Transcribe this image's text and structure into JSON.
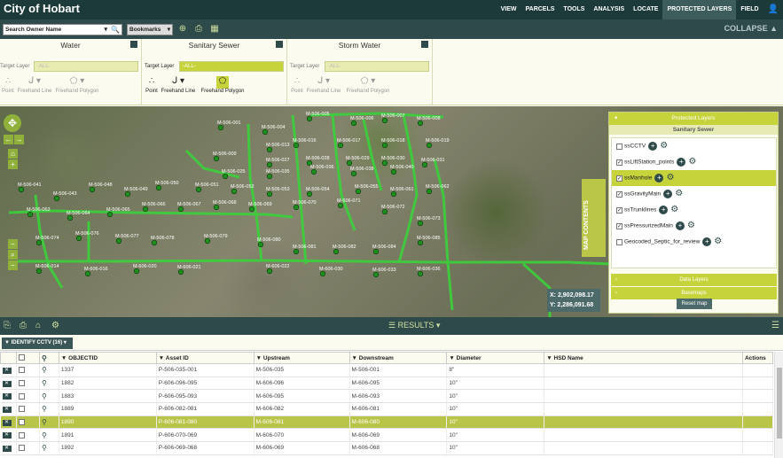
{
  "app": {
    "title": "City of Hobart"
  },
  "nav": [
    "VIEW",
    "PARCELS",
    "TOOLS",
    "ANALYSIS",
    "LOCATE",
    "PROTECTED LAYERS",
    "FIELD"
  ],
  "toolbar": {
    "search_value": "Search Owner Name",
    "bookmarks_label": "Bookmarks",
    "collapse_label": "COLLAPSE"
  },
  "edit_panels": [
    {
      "title": "Water",
      "target_label": "Target Layer",
      "target_value": "-ALL-",
      "tools": [
        "Point",
        "Freehand Line",
        "Freehand Polygon"
      ]
    },
    {
      "title": "Sanitary Sewer",
      "target_label": "Target Layer",
      "target_value": "-ALL-",
      "tools": [
        "Point",
        "Freehand Line",
        "Freehand Polygon"
      ]
    },
    {
      "title": "Storm Water",
      "target_label": "Target Layer",
      "target_value": "-ALL-",
      "tools": [
        "Point",
        "Freehand Line",
        "Freehand Polygon"
      ]
    }
  ],
  "map": {
    "labels": [
      "M-506-001",
      "M-506-004",
      "M-506-005",
      "M-506-006",
      "M-506-007",
      "M-506-008",
      "M-506-009",
      "M-506-013",
      "M-506-016",
      "M-506-017",
      "M-506-018",
      "M-506-019",
      "M-506-025",
      "M-506-027",
      "M-506-028",
      "M-506-029",
      "M-506-030",
      "M-506-031",
      "M-506-035",
      "M-506-036",
      "M-506-038",
      "M-506-040",
      "M-506-041",
      "M-506-043",
      "M-506-048",
      "M-506-049",
      "M-506-050",
      "M-506-051",
      "M-506-052",
      "M-506-053",
      "M-506-054",
      "M-506-055",
      "M-506-061",
      "M-506-062",
      "M-506-063",
      "M-506-064",
      "M-506-065",
      "M-506-066",
      "M-506-067",
      "M-506-068",
      "M-506-069",
      "M-506-070",
      "M-506-071",
      "M-506-072",
      "M-506-073",
      "M-506-074",
      "M-506-076",
      "M-506-077",
      "M-506-078",
      "M-506-079",
      "M-506-080",
      "M-506-081",
      "M-506-082",
      "M-506-084",
      "M-506-085",
      "M-606-014",
      "M-606-016",
      "M-606-020",
      "M-606-021",
      "M-606-022",
      "M-606-030",
      "M-606-033",
      "M-606-036"
    ],
    "coord_x": "X: 2,902,098.17",
    "coord_y": "Y: 2,286,091.68",
    "map_contents_label": "MAP CONTENTS"
  },
  "layers": {
    "header": "Protected Layers",
    "subheader": "Sanitary Sewer",
    "items": [
      {
        "name": "ssCCTV",
        "checked": false
      },
      {
        "name": "ssLiftStation_points",
        "checked": true
      },
      {
        "name": "ssManhole",
        "checked": true
      },
      {
        "name": "ssGravityMain",
        "checked": true
      },
      {
        "name": "ssTrunklines",
        "checked": true
      },
      {
        "name": "ssPressurizedMain",
        "checked": true
      },
      {
        "name": "Geocoded_Septic_for_review",
        "checked": false
      }
    ],
    "data_layers": "Data Layers",
    "basemaps": "Basemaps",
    "reset": "Reset map"
  },
  "results": {
    "label": "RESULTS",
    "tab": "IDENTIFY CCTV (16)",
    "columns": [
      "OBJECTID",
      "Asset ID",
      "Upstream",
      "Downstream",
      "Diameter",
      "HSD Name",
      "Actions"
    ],
    "rows": [
      [
        "1337",
        "P-506-035-001",
        "M-506-035",
        "M-506-001",
        "8\""
      ],
      [
        "1882",
        "P-606-096-095",
        "M-606-096",
        "M-606-095",
        "10\""
      ],
      [
        "1883",
        "P-606-095-093",
        "M-606-095",
        "M-606-093",
        "10\""
      ],
      [
        "1889",
        "P-606-082-081",
        "M-606-082",
        "M-606-081",
        "10\""
      ],
      [
        "1890",
        "P-606-081-080",
        "M-606-081",
        "M-606-080",
        "10\""
      ],
      [
        "1891",
        "P-606-070-069",
        "M-606-070",
        "M-606-069",
        "10\""
      ],
      [
        "1892",
        "P-606-069-068",
        "M-606-069",
        "M-606-068",
        "10\""
      ]
    ]
  }
}
